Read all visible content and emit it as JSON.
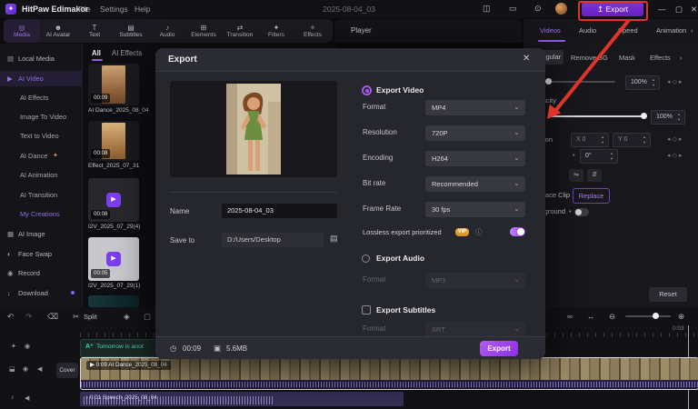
{
  "colors": {
    "accent": "#9b5cf0",
    "annotation_red": "#e0342a",
    "toggle_on": "#9333ea",
    "vip_gold": "#e8a23e",
    "clip_teal": "#3ed3b4"
  },
  "icons": {
    "logo": "✦",
    "layout": "◫",
    "comment": "▭",
    "download_circle": "⊙",
    "export_arrow": "↥",
    "minimize": "—",
    "maximize": "▢",
    "close": "✕",
    "chevron_right": "›",
    "chevron_down": "⌄",
    "folder": "▤",
    "clock": "◷",
    "disk": "▣",
    "undo": "↶",
    "redo": "↷",
    "trash": "⌫",
    "scissors": "✂",
    "shield": "◈",
    "frame": "▢",
    "link": "∞",
    "fit": "↔",
    "zoom_out": "⊖",
    "zoom_in": "⊕",
    "play": "▶",
    "note": "♪",
    "eye": "◉",
    "lock": "⬓",
    "speaker": "◀",
    "sparkle": "✦",
    "flip_h": "⇋",
    "flip_v": "⇵",
    "kf_left": "◂",
    "kf_diamond": "◇",
    "kf_right": "▸",
    "info": "ⓘ",
    "dot": "•",
    "spin_up": "▴",
    "spin_down": "▾",
    "text_badge": "A⁺"
  },
  "titlebar": {
    "app_name": "HitPaw Edimakor",
    "menus": [
      "File",
      "Settings",
      "Help"
    ],
    "document_title": "2025-08-04_03",
    "export_label": "Export"
  },
  "toolbar": {
    "items": [
      {
        "label": "Media",
        "glyph": "◎"
      },
      {
        "label": "AI Avatar",
        "glyph": "☻"
      },
      {
        "label": "Text",
        "glyph": "T"
      },
      {
        "label": "Subtitles",
        "glyph": "▤"
      },
      {
        "label": "Audio",
        "glyph": "♪"
      },
      {
        "label": "Elements",
        "glyph": "⊞"
      },
      {
        "label": "Transition",
        "glyph": "⇄"
      },
      {
        "label": "Filters",
        "glyph": "✦"
      },
      {
        "label": "Effects",
        "glyph": "✧"
      }
    ],
    "player_label": "Player"
  },
  "right_tabs": [
    "Videos",
    "Audio",
    "Speed",
    "Animation"
  ],
  "sidebar": {
    "items": [
      {
        "label": "Local Media",
        "glyph": "▤"
      },
      {
        "label": "AI Video",
        "glyph": "▶"
      },
      {
        "label": "AI Effects"
      },
      {
        "label": "Image To Video"
      },
      {
        "label": "Text to Video"
      },
      {
        "label": "AI Dance"
      },
      {
        "label": "AI Animation"
      },
      {
        "label": "AI Transition"
      },
      {
        "label": "My Creations"
      },
      {
        "label": "AI Image",
        "glyph": "▦"
      },
      {
        "label": "Face Swap",
        "glyph": "◐"
      },
      {
        "label": "Record",
        "glyph": "◉"
      },
      {
        "label": "Download",
        "glyph": "↓"
      }
    ]
  },
  "media_panel": {
    "tabs": [
      "All",
      "AI Effects"
    ],
    "items": [
      {
        "duration": "00:09",
        "label": "AI Dance_2025_08_04"
      },
      {
        "duration": "00:08",
        "label": "Effect_2025_07_31"
      },
      {
        "duration": "00:08",
        "label": "I2V_2025_07_29(4)"
      },
      {
        "duration": "00:05",
        "label": "I2V_2025_07_29(1)"
      }
    ]
  },
  "right_panel": {
    "subtabs": [
      "Regular",
      "Remove BG",
      "Mask",
      "Effects"
    ],
    "scale_value": "100%",
    "opacity_label": "Opacity",
    "opacity_value": "100%",
    "position_label": "Position",
    "pos_x_label": "X 0",
    "pos_y_label": "Y 0",
    "rotate_value": "0°",
    "replace_label": "Replace Clip",
    "replace_button": "Replace",
    "background_label": "Background",
    "reset_button": "Reset"
  },
  "dialog": {
    "title": "Export",
    "name_label": "Name",
    "name_value": "2025-08-04_03",
    "save_label": "Save to",
    "save_value": "D:/Users/Desktop",
    "video_section": "Export Video",
    "video_fields": [
      {
        "label": "Format",
        "value": "MP4"
      },
      {
        "label": "Resolution",
        "value": "720P"
      },
      {
        "label": "Encoding",
        "value": "H264"
      },
      {
        "label": "Bit rate",
        "value": "Recommended"
      },
      {
        "label": "Frame Rate",
        "value": "30 fps"
      }
    ],
    "lossless_label": "Lossless export prioritized",
    "vip_badge": "VIP",
    "audio_section": "Export Audio",
    "audio_format_label": "Format",
    "audio_format_value": "MP3",
    "subtitle_section": "Export Subtitles",
    "subtitle_format_label": "Format",
    "subtitle_format_value": "SRT",
    "duration": "00:09",
    "filesize": "5.6MB",
    "export_button": "Export"
  },
  "timeline": {
    "split_label": "Split",
    "ruler_end": "0:03",
    "cover_button": "Cover",
    "text_clip": "Tomorrow is anot",
    "video_clip": "0:09 AI Dance_2025_08_04",
    "audio_clip": "0:01 Speech_2025_08_04"
  }
}
